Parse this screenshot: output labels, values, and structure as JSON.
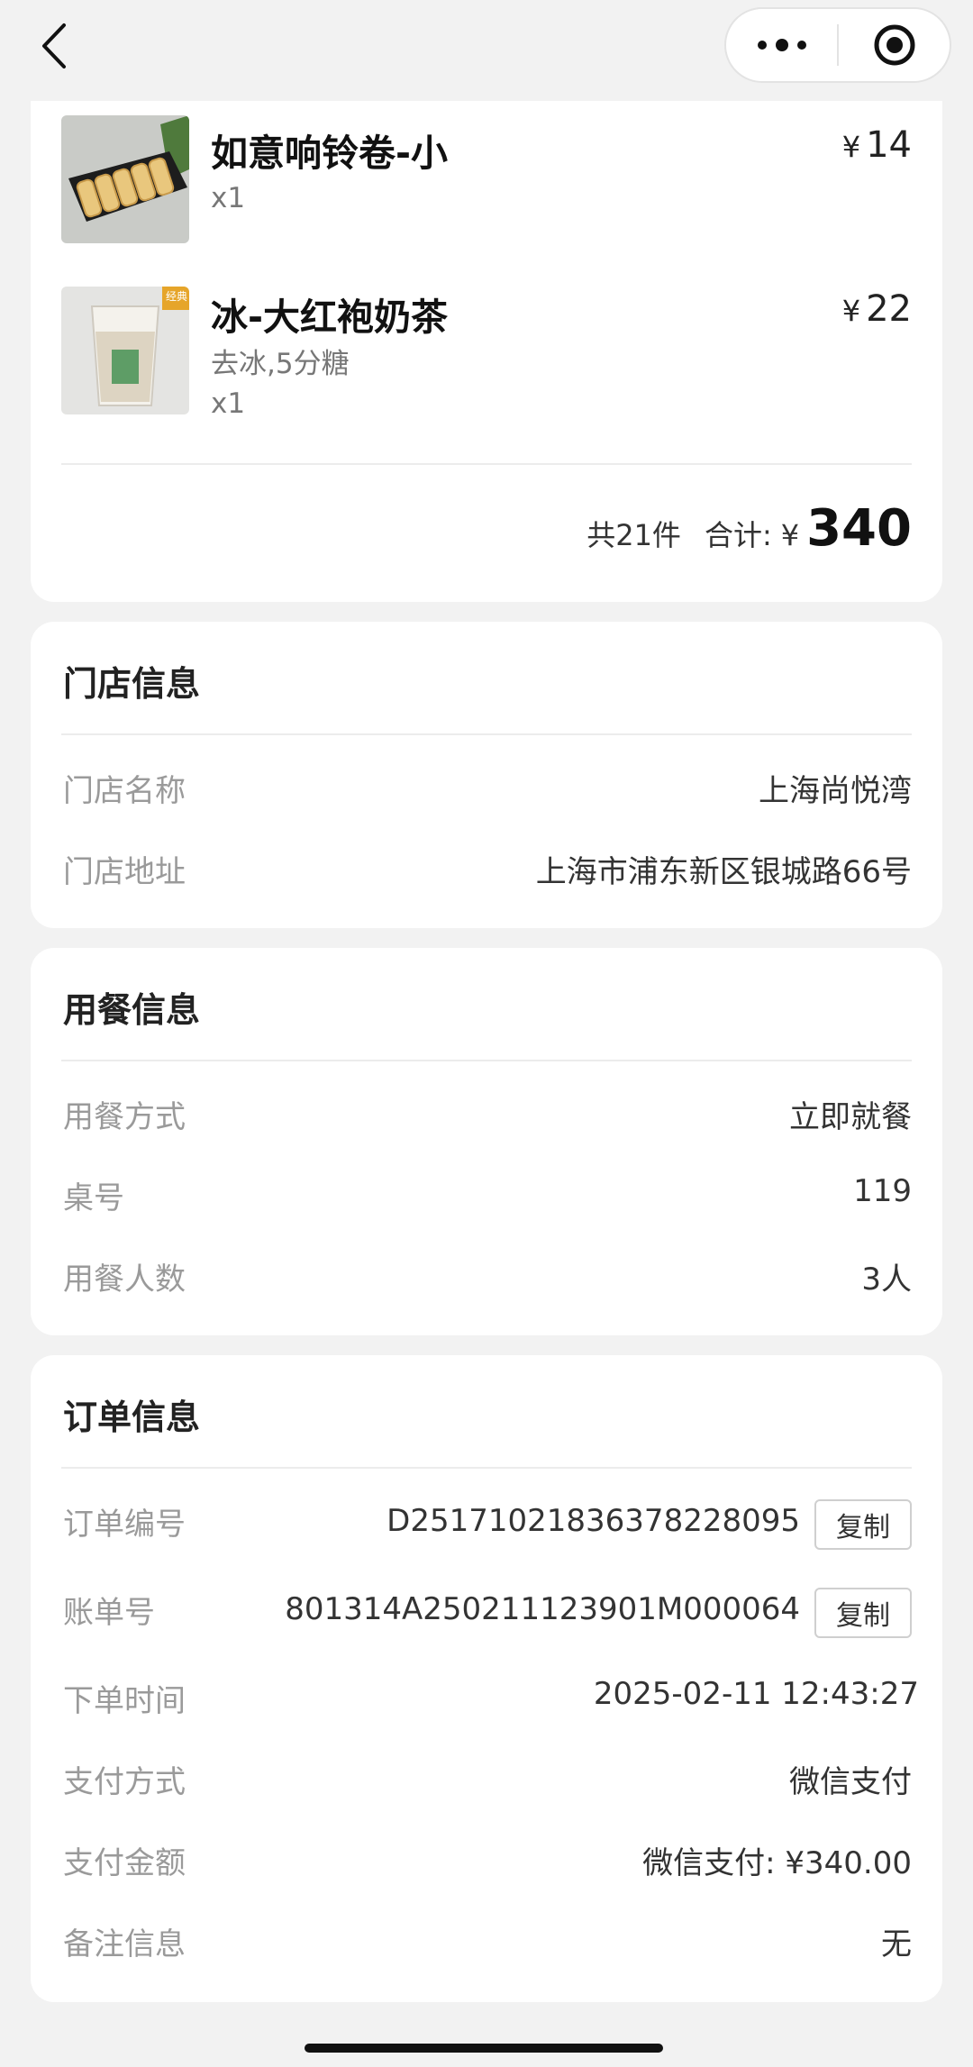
{
  "nav": {
    "back_icon": "chevron-left-icon",
    "more_icon": "more-dots-icon",
    "close_icon": "target-circle-icon"
  },
  "items": [
    {
      "name": "如意响铃卷-小",
      "currency": "¥",
      "price": "14",
      "spec": "",
      "qty": "x1",
      "image_icon": "rice-roll-dish-image"
    },
    {
      "name": "冰-大红袍奶茶",
      "currency": "¥",
      "price": "22",
      "spec": "去冰,5分糖",
      "qty": "x1",
      "image_icon": "milk-tea-cup-image",
      "badge": "经典"
    }
  ],
  "summary": {
    "count_text": "共21件",
    "total_label": "合计:",
    "currency": "¥",
    "total_amount": "340"
  },
  "store": {
    "title": "门店信息",
    "name_label": "门店名称",
    "name_value": "上海尚悦湾",
    "address_label": "门店地址",
    "address_value": "上海市浦东新区银城路66号"
  },
  "dining": {
    "title": "用餐信息",
    "mode_label": "用餐方式",
    "mode_value": "立即就餐",
    "table_label": "桌号",
    "table_value": "119",
    "people_label": "用餐人数",
    "people_value": "3人"
  },
  "order": {
    "title": "订单信息",
    "order_no_label": "订单编号",
    "order_no_value": "D251710218363782280​95",
    "bill_no_label": "账单号",
    "bill_no_value": "801314A250211123901M000064",
    "copy_label": "复制",
    "time_label": "下单时间",
    "time_value": "2025-02-11 12:43:27",
    "pay_method_label": "支付方式",
    "pay_method_value": "微信支付",
    "pay_amount_label": "支付金额",
    "pay_amount_value": "微信支付: ¥340.00",
    "remark_label": "备注信息",
    "remark_value": "无"
  }
}
